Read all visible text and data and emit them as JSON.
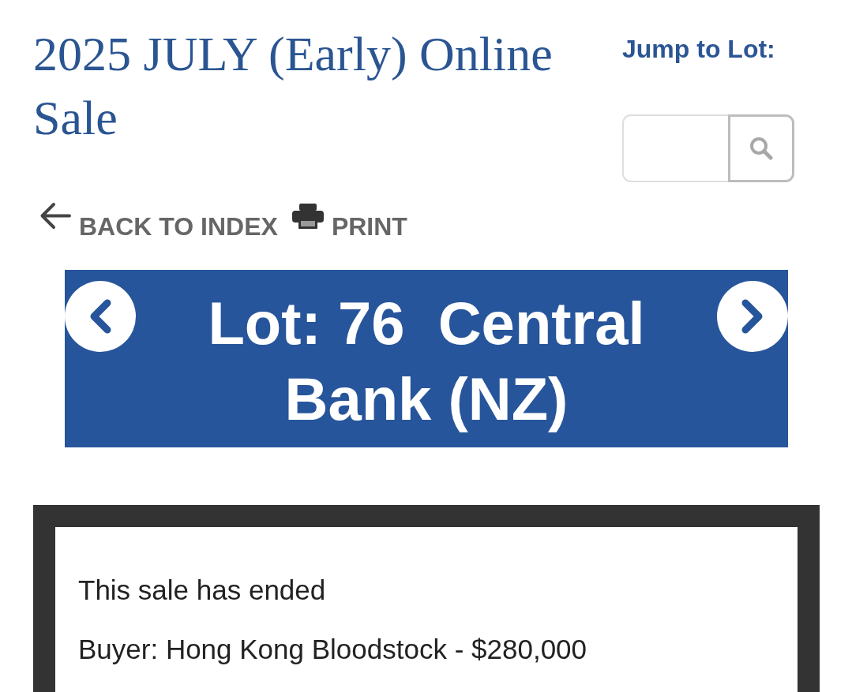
{
  "header": {
    "title": "2025 JULY (Early) Online Sale",
    "jump_to_lot": {
      "label": "Jump to Lot:"
    }
  },
  "links": [
    {
      "kind": "back",
      "label": "BACK TO INDEX"
    },
    {
      "kind": "print",
      "label": "PRINT"
    }
  ],
  "lot_banner": {
    "title": "Lot: 76  Central Bank (NZ)"
  },
  "result": {
    "lines": [
      "This sale has ended",
      "Buyer: Hong Kong Bloodstock - $280,000"
    ]
  }
}
